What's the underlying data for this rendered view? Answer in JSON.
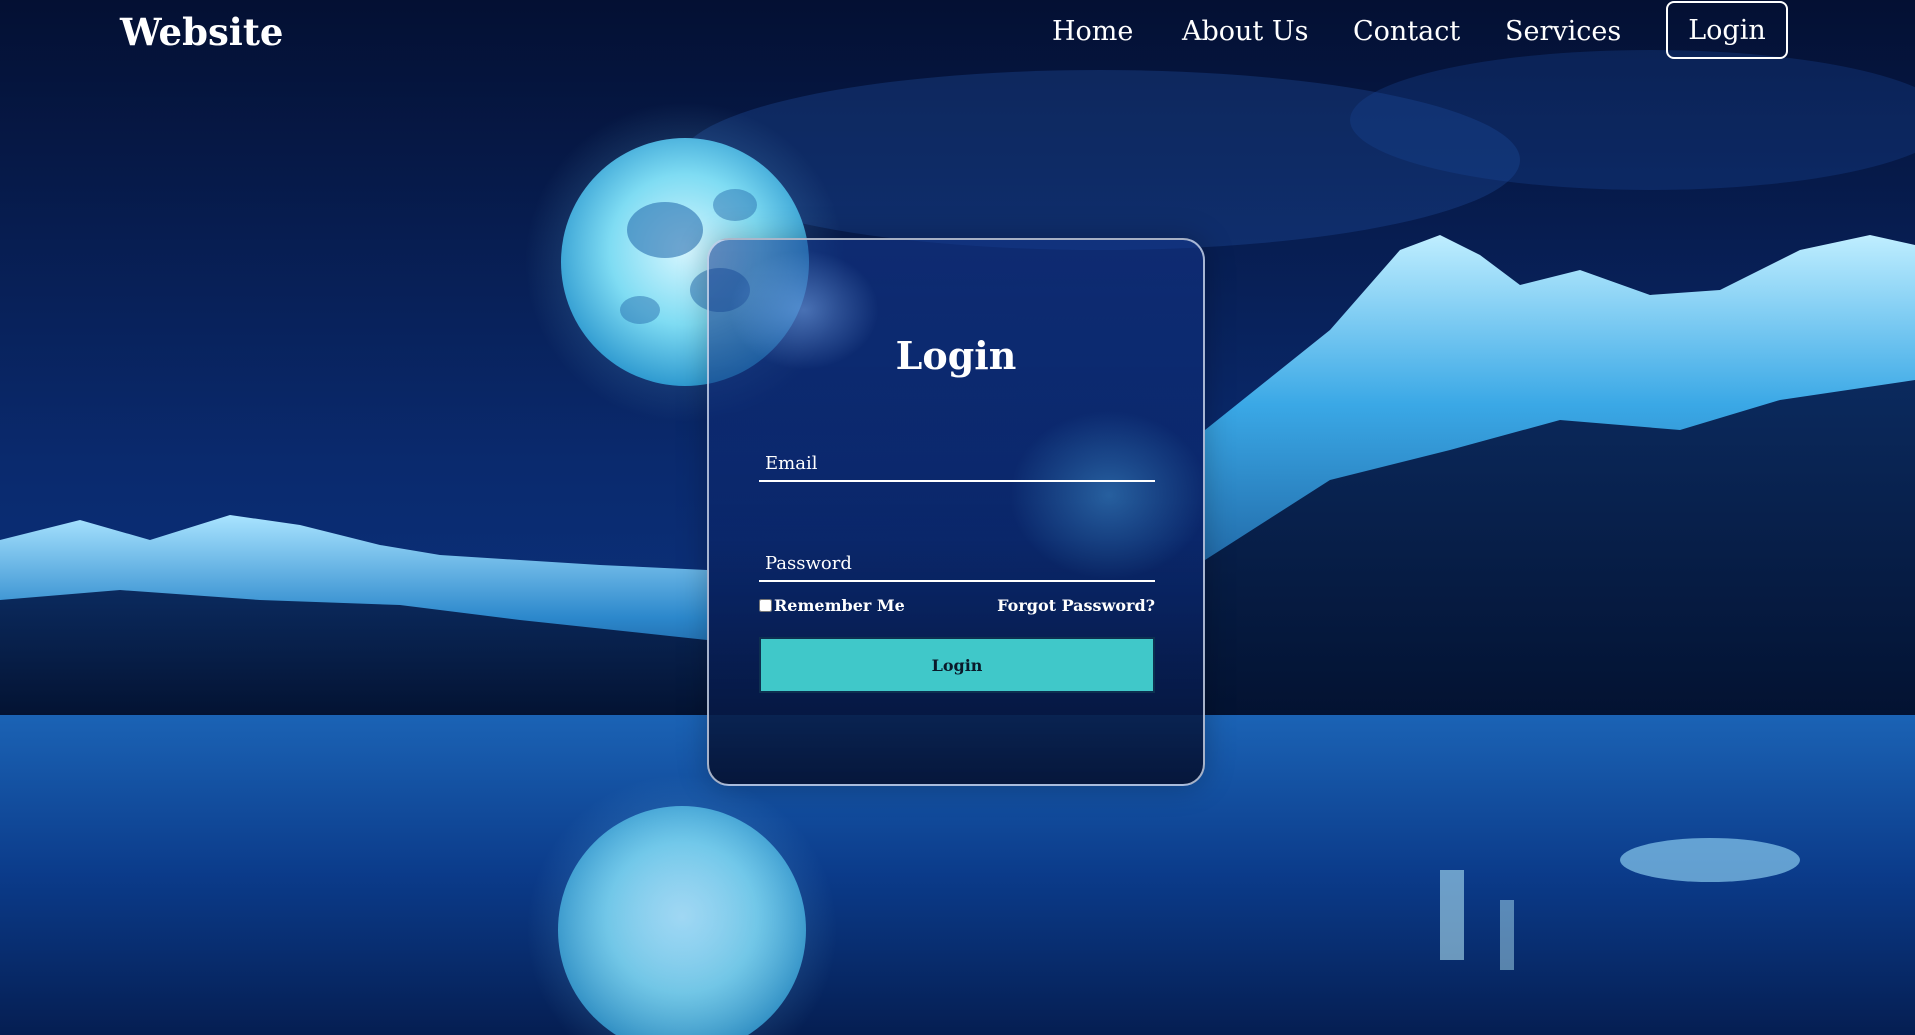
{
  "nav": {
    "brand": "Website",
    "links": [
      "Home",
      "About Us",
      "Contact",
      "Services"
    ],
    "login_label": "Login"
  },
  "form": {
    "title": "Login",
    "email_placeholder": "Email",
    "password_placeholder": "Password",
    "remember_label": "Remember Me",
    "forgot_label": "Forgot Password?",
    "submit_label": "Login"
  },
  "colors": {
    "accent_button": "#40c8c9",
    "background_dark": "#06122e",
    "text": "#ffffff"
  }
}
